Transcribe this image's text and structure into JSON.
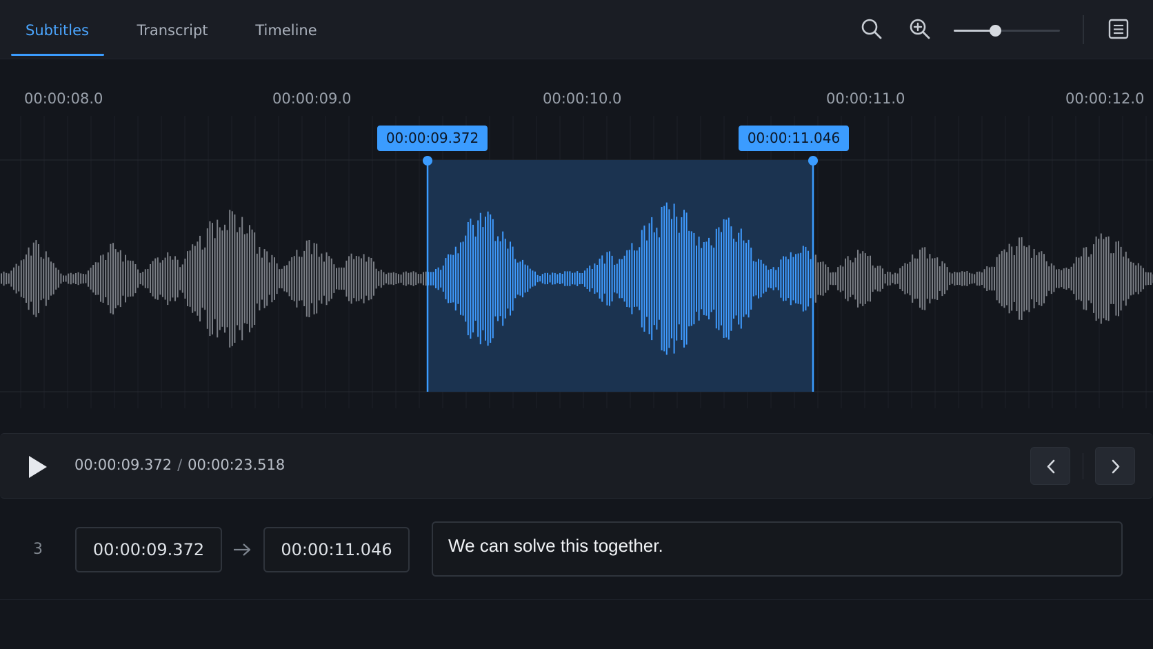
{
  "tabs": [
    {
      "label": "Subtitles",
      "active": true
    },
    {
      "label": "Transcript",
      "active": false
    },
    {
      "label": "Timeline",
      "active": false
    }
  ],
  "toolbar": {
    "icons": [
      "search-icon",
      "zoom-in-icon",
      "list-icon"
    ],
    "zoom_level": 0.39
  },
  "timeline": {
    "ruler": [
      "00:00:08.0",
      "00:00:09.0",
      "00:00:10.0",
      "00:00:11.0",
      "00:00:12.0"
    ],
    "selection": {
      "start": "00:00:09.372",
      "end": "00:00:11.046"
    }
  },
  "transport": {
    "current_time": "00:00:09.372",
    "separator": "/",
    "total_time": "00:00:23.518"
  },
  "subtitle": {
    "index": "3",
    "start": "00:00:09.372",
    "end": "00:00:11.046",
    "text": "We can solve this together."
  },
  "colors": {
    "accent": "#3b9cff",
    "waveform_inactive": "#7b7f86",
    "waveform_active": "#3f9bff",
    "selection_fill": "#1b3350",
    "background": "#13161c"
  }
}
